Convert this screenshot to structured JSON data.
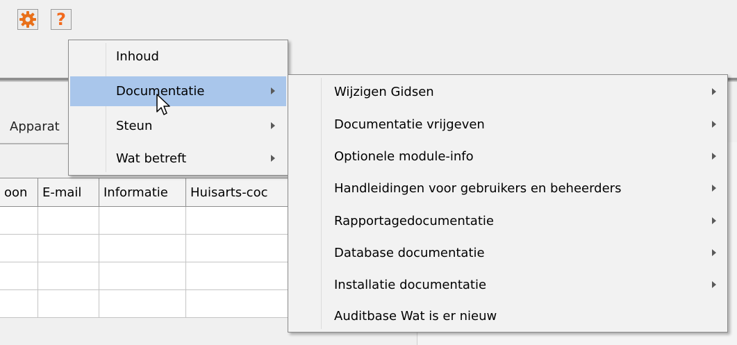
{
  "toolbar": {
    "settings_icon": "gear-icon",
    "help_label": "?",
    "accent_color": "#e8701a"
  },
  "tab": {
    "label": "Apparat"
  },
  "grid": {
    "columns": [
      "oon",
      "E-mail",
      "Informatie",
      "Huisarts-coc"
    ],
    "row_count": 4
  },
  "help_menu": {
    "items": [
      {
        "label": "Inhoud",
        "submenu": false
      },
      {
        "label": "Documentatie",
        "submenu": true,
        "highlighted": true
      },
      {
        "label": "Steun",
        "submenu": true
      },
      {
        "label": "Wat betreft",
        "submenu": true
      }
    ]
  },
  "documentation_menu": {
    "items": [
      {
        "label": "Wijzigen Gidsen",
        "submenu": true
      },
      {
        "label": "Documentatie vrijgeven",
        "submenu": true
      },
      {
        "label": "Optionele module-info",
        "submenu": true
      },
      {
        "label": "Handleidingen voor gebruikers en beheerders",
        "submenu": true
      },
      {
        "label": "Rapportagedocumentatie",
        "submenu": true
      },
      {
        "label": "Database documentatie",
        "submenu": true
      },
      {
        "label": "Installatie documentatie",
        "submenu": true
      },
      {
        "label": "Auditbase Wat is er nieuw",
        "submenu": false
      }
    ]
  }
}
